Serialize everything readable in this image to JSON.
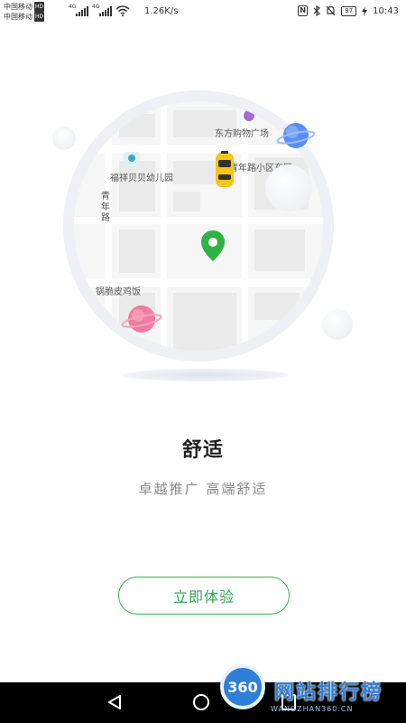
{
  "status_bar": {
    "carrier_1": "中国移动",
    "carrier_2": "中国移动",
    "hd_badge": "HD",
    "network_1": "4G",
    "network_2": "4G",
    "speed": "1.26K/s",
    "battery": "97",
    "time": "10:43"
  },
  "map": {
    "labels": {
      "mall": "东方购物广场",
      "kindergarten": "福祥贝贝幼儿园",
      "community": "青年路小区东区",
      "road_vertical": "青年路",
      "restaurant": "锅脆皮鸡饭"
    },
    "icons": {
      "location": "map-pin-icon",
      "taxi": "taxi-icon",
      "planet_blue": "planet-icon",
      "planet_pink": "planet-icon"
    }
  },
  "content": {
    "title": "舒适",
    "subtitle": "卓越推广  高端舒适",
    "cta_label": "立即体验"
  },
  "colors": {
    "accent": "#37b24d",
    "nav_bar": "#000000",
    "watermark": "#2e7fd8"
  },
  "watermark": {
    "badge": "360",
    "text": "网站排行榜",
    "url": "WANGZHAN360.CN"
  }
}
